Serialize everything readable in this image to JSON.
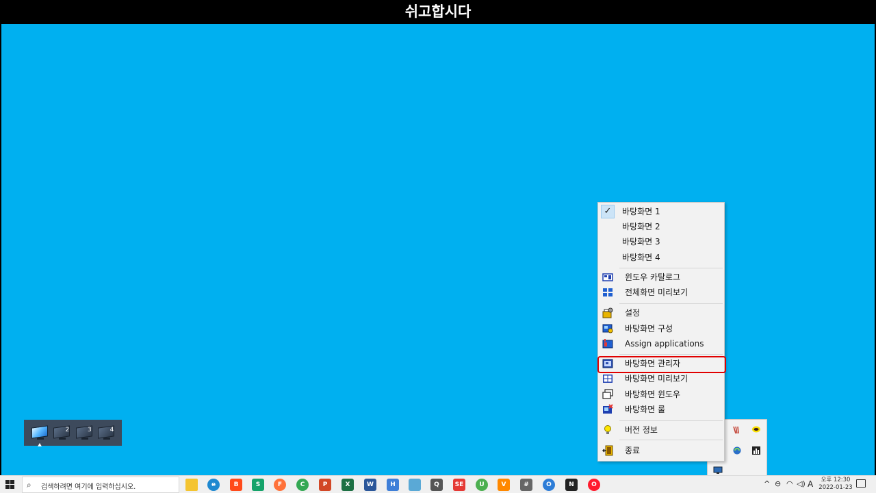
{
  "header": {
    "title": "쉬고합시다"
  },
  "pager": {
    "items": [
      "1",
      "2",
      "3",
      "4"
    ],
    "active_index": 0
  },
  "menu": {
    "group_desktops": [
      {
        "label": "바탕화면 1",
        "checked": true
      },
      {
        "label": "바탕화면 2",
        "checked": false
      },
      {
        "label": "바탕화면 3",
        "checked": false
      },
      {
        "label": "바탕화면 4",
        "checked": false
      }
    ],
    "window_catalog": "윈도우 카탈로그",
    "fullscreen_preview": "전체화면 미리보기",
    "settings": "설정",
    "desktop_config": "바탕화면 구성",
    "assign_apps": "Assign applications",
    "desktop_manager": "바탕화면 관리자",
    "desktop_preview": "바탕화면 미리보기",
    "desktop_window": "바탕화면 윈도우",
    "desktop_rule": "바탕화면 룰",
    "version_info": "버전 정보",
    "exit": "종료",
    "highlighted_item": "바탕화면 관리자"
  },
  "taskbar": {
    "search_placeholder": "검색하려면 여기에 입력하십시오.",
    "apps": [
      {
        "name": "file-explorer",
        "color": "#f4c430",
        "glyph": ""
      },
      {
        "name": "edge",
        "color": "#1e88d0",
        "glyph": "e"
      },
      {
        "name": "brave",
        "color": "#ff4a1a",
        "glyph": "B"
      },
      {
        "name": "app-green",
        "color": "#15a36a",
        "glyph": "S"
      },
      {
        "name": "firefox",
        "color": "#ff7139",
        "glyph": "F"
      },
      {
        "name": "chrome",
        "color": "#34a853",
        "glyph": "C"
      },
      {
        "name": "powerpoint",
        "color": "#d24726",
        "glyph": "P"
      },
      {
        "name": "excel",
        "color": "#1d7044",
        "glyph": "X"
      },
      {
        "name": "word",
        "color": "#2b579a",
        "glyph": "W"
      },
      {
        "name": "app-blue",
        "color": "#3f7fd8",
        "glyph": "H"
      },
      {
        "name": "app-monitor",
        "color": "#5aa9d6",
        "glyph": ""
      },
      {
        "name": "search-tool",
        "color": "#555555",
        "glyph": "Q"
      },
      {
        "name": "app-red",
        "color": "#e53935",
        "glyph": "SE"
      },
      {
        "name": "app-green-circle",
        "color": "#4caf50",
        "glyph": "U"
      },
      {
        "name": "vlc",
        "color": "#ff8800",
        "glyph": "V"
      },
      {
        "name": "calculator",
        "color": "#666666",
        "glyph": "#"
      },
      {
        "name": "app-ring",
        "color": "#2e7dd7",
        "glyph": "O"
      },
      {
        "name": "sticky-notes",
        "color": "#222222",
        "glyph": "N"
      },
      {
        "name": "opera",
        "color": "#ff1b2d",
        "glyph": "O"
      }
    ],
    "ime": "A",
    "clock_period_time": "오후 12:30",
    "clock_date": "2022-01-23"
  }
}
